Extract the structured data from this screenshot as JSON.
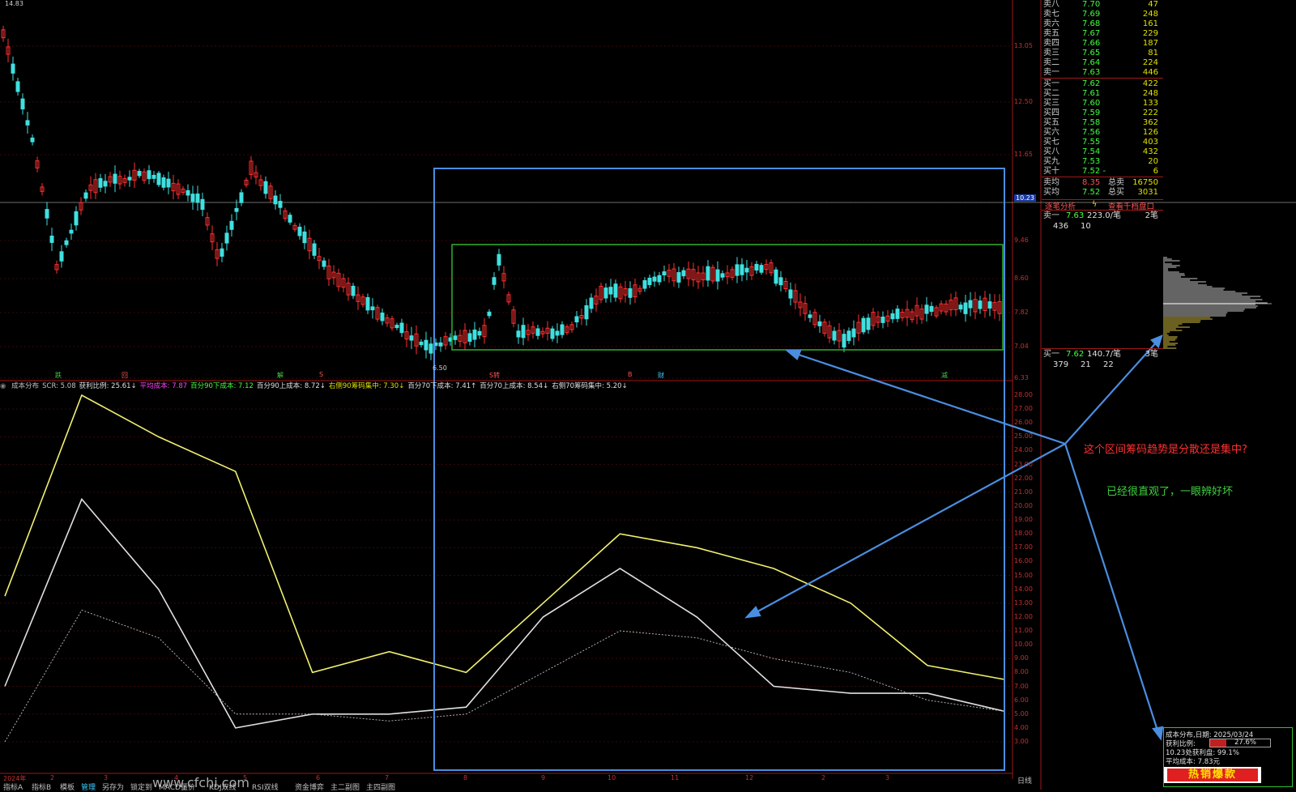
{
  "price_chart": {
    "ticker_high": "14.83",
    "low_marker": "6.50",
    "current_price_tag": "10.23",
    "y_ticks": [
      "13.05",
      "12.50",
      "11.65",
      "10.23",
      "9.46",
      "8.60",
      "7.82",
      "7.04",
      "6.33"
    ],
    "event_markers": [
      "跌",
      "回",
      "解",
      "S",
      "S转",
      "B",
      "财",
      "减"
    ]
  },
  "indicator_bar": {
    "items": [
      {
        "text": "成本分布",
        "color": "#c0c0c0"
      },
      {
        "text": "SCR: 5.08",
        "color": "#c0c0c0"
      },
      {
        "text": "获利比例: 25.61↓",
        "color": "#e0e0e0"
      },
      {
        "text": "平均成本: 7.87",
        "color": "#ff40ff"
      },
      {
        "text": "百分90下成本: 7.12",
        "color": "#40ff40"
      },
      {
        "text": "百分90上成本: 8.72↓",
        "color": "#e0e0e0"
      },
      {
        "text": "右侧90筹码集中: 7.30↓",
        "color": "#e0e000"
      },
      {
        "text": "百分70下成本: 7.41↑",
        "color": "#e0e0e0"
      },
      {
        "text": "百分70上成本: 8.54↓",
        "color": "#e0e0e0"
      },
      {
        "text": "右侧70筹码集中: 5.20↓",
        "color": "#e0e0e0"
      }
    ]
  },
  "indicator_axis": [
    "28.00",
    "27.00",
    "26.00",
    "25.00",
    "24.00",
    "23.00",
    "22.00",
    "21.00",
    "20.00",
    "19.00",
    "18.00",
    "17.00",
    "16.00",
    "15.00",
    "14.00",
    "13.00",
    "12.00",
    "11.00",
    "10.00",
    "9.00",
    "8.00",
    "7.00",
    "6.00",
    "5.00",
    "4.00",
    "3.00"
  ],
  "time_axis": [
    "2024年",
    "2",
    "3",
    "4",
    "5",
    "6",
    "7",
    "8",
    "9",
    "10",
    "11",
    "12",
    "2",
    "3"
  ],
  "order_book": {
    "asks": [
      {
        "label": "卖八",
        "price": "7.70",
        "vol": "47"
      },
      {
        "label": "卖七",
        "price": "7.69",
        "vol": "248"
      },
      {
        "label": "卖六",
        "price": "7.68",
        "vol": "161"
      },
      {
        "label": "卖五",
        "price": "7.67",
        "vol": "229"
      },
      {
        "label": "卖四",
        "price": "7.66",
        "vol": "187"
      },
      {
        "label": "卖三",
        "price": "7.65",
        "vol": "81"
      },
      {
        "label": "卖二",
        "price": "7.64",
        "vol": "224"
      },
      {
        "label": "卖一",
        "price": "7.63",
        "vol": "446"
      }
    ],
    "bids": [
      {
        "label": "买一",
        "price": "7.62",
        "vol": "422"
      },
      {
        "label": "买二",
        "price": "7.61",
        "vol": "248"
      },
      {
        "label": "买三",
        "price": "7.60",
        "vol": "133"
      },
      {
        "label": "买四",
        "price": "7.59",
        "vol": "222"
      },
      {
        "label": "买五",
        "price": "7.58",
        "vol": "362"
      },
      {
        "label": "买六",
        "price": "7.56",
        "vol": "126"
      },
      {
        "label": "买七",
        "price": "7.55",
        "vol": "403"
      },
      {
        "label": "买八",
        "price": "7.54",
        "vol": "432"
      },
      {
        "label": "买九",
        "price": "7.53",
        "vol": "20"
      },
      {
        "label": "买十",
        "price": "7.52 -",
        "vol": "6"
      }
    ],
    "ask_avg_label": "卖均",
    "ask_avg": "8.35",
    "ask_total_label": "总卖",
    "ask_total": "16750",
    "bid_avg_label": "买均",
    "bid_avg": "7.52",
    "bid_total_label": "总买",
    "bid_total": "3031",
    "tab1": "逐笔分析",
    "tab2": "查看千档盘口",
    "sell1_label": "卖一",
    "sell1_price": "7.63",
    "sell1_size": "223.0/笔",
    "sell1_count": "2笔",
    "sell1_sub": [
      "436",
      "10"
    ],
    "buy1_label": "买一",
    "buy1_price": "7.62",
    "buy1_size": "140.7/笔",
    "buy1_count": "3笔",
    "buy1_sub": [
      "379",
      "21",
      "22"
    ]
  },
  "annotation": {
    "question": "这个区间筹码趋势是分散还是集中?",
    "answer": "已经很直观了，一眼辨好坏"
  },
  "cost_panel": {
    "row1_label": "成本分布,日期:",
    "row1_value": "2025/03/24",
    "row2_label": "获利比例:",
    "row2_value": "27.6%",
    "row3_label": "10.23处获利盘:",
    "row3_value": "99.1%",
    "row4_label": "平均成本:",
    "row4_value": "7.83元",
    "banner": "热销爆款"
  },
  "bottom_tabs": [
    "指标A",
    "指标B",
    "模板",
    "管理",
    "另存为",
    "锁定到",
    "MACD量价",
    "KDJ双线",
    "RSI双线",
    "资金博弈",
    "主二副图",
    "主四副图"
  ],
  "period_label": "日线",
  "watermark": "www.cfchi.com",
  "chart_data": {
    "type": "line",
    "title": "",
    "x": [
      "2024年",
      "2",
      "3",
      "4",
      "5",
      "6",
      "7",
      "8",
      "9",
      "10",
      "11",
      "12",
      "2",
      "3"
    ],
    "series": [
      {
        "name": "百分90上成本",
        "color": "#f0f070",
        "values": [
          13.5,
          28,
          25,
          22.5,
          8,
          9.5,
          8,
          13,
          18,
          17,
          15.5,
          13,
          8.5,
          7.5
        ]
      },
      {
        "name": "百分70上成本",
        "color": "#e0e0e0",
        "values": [
          7,
          20.5,
          14,
          4,
          5,
          5,
          5.5,
          12,
          15.5,
          12,
          7,
          6.5,
          6.5,
          5.2
        ]
      },
      {
        "name": "右侧70筹码集中",
        "color": "#b0b0b0",
        "values": [
          3,
          12.5,
          10.5,
          5,
          5,
          4.5,
          5,
          8,
          11,
          10.5,
          9,
          8,
          6,
          5.2
        ]
      }
    ],
    "ylim": [
      3,
      28
    ]
  }
}
